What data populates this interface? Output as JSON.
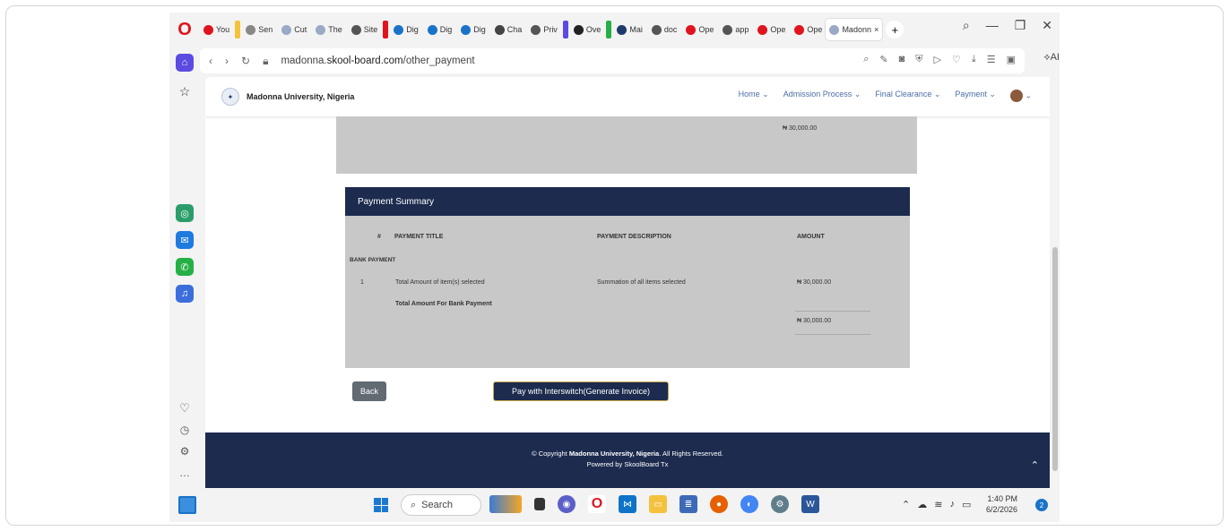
{
  "browser": {
    "tabs": [
      {
        "label": "You",
        "color": "#e0141e"
      },
      {
        "label": "Sen",
        "color": "#888888"
      },
      {
        "label": "Cut",
        "color": "#9aa9c4"
      },
      {
        "label": "The",
        "color": "#9aa9c4"
      },
      {
        "label": "Site",
        "color": "#555555"
      },
      {
        "label": "Dig",
        "color": "#1a73c9"
      },
      {
        "label": "Dig",
        "color": "#1a73c9"
      },
      {
        "label": "Dig",
        "color": "#1a73c9"
      },
      {
        "label": "Cha",
        "color": "#444444"
      },
      {
        "label": "Priv",
        "color": "#555555"
      },
      {
        "label": "Ove",
        "color": "#222222"
      },
      {
        "label": "Mai",
        "color": "#1e3a6d"
      },
      {
        "label": "doc",
        "color": "#555555"
      },
      {
        "label": "Ope",
        "color": "#e0141e"
      },
      {
        "label": "app",
        "color": "#555555"
      },
      {
        "label": "Ope",
        "color": "#e0141e"
      },
      {
        "label": "Ope",
        "color": "#e0141e"
      }
    ],
    "active_tab": "Madonn",
    "url_prefix": "madonna.",
    "url_domain": "skool-board.com",
    "url_path": "/other_payment",
    "ai_label": "AI"
  },
  "site": {
    "name": "Madonna University, Nigeria",
    "nav": {
      "home": "Home ⌄",
      "admission": "Admission Process ⌄",
      "clearance": "Final Clearance ⌄",
      "payment": "Payment ⌄"
    }
  },
  "top_amount": "₦ 30,000.00",
  "summary": {
    "title": "Payment Summary",
    "headers": {
      "num": "#",
      "title": "PAYMENT TITLE",
      "desc": "PAYMENT DESCRIPTION",
      "amount": "AMOUNT"
    },
    "group": "BANK PAYMENT",
    "row": {
      "num": "1",
      "title": "Total Amount of item(s) selected",
      "desc": "Summation of all items selected",
      "amount": "₦ 30,000.00"
    },
    "total_label": "Total Amount For Bank Payment",
    "total_amount": "₦ 30,000.00"
  },
  "buttons": {
    "back": "Back",
    "pay": "Pay with Interswitch(Generate Invoice)"
  },
  "footer": {
    "copyright_prefix": "© Copyright",
    "copyright_name": "Madonna University, Nigeria",
    "copyright_suffix": ". All Rights Reserved.",
    "powered": "Powered by SkoolBoard Tx"
  },
  "taskbar": {
    "search_placeholder": "Search",
    "time": "1:40 PM",
    "date": "6/2/2026",
    "notifications": "2"
  }
}
